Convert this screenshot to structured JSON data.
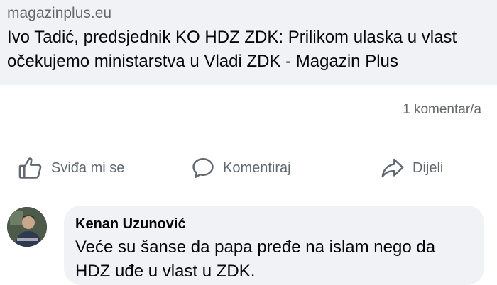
{
  "link_preview": {
    "domain": "magazinplus.eu",
    "title": "Ivo Tadić, predsjednik KO HDZ ZDK: Prilikom ulaska u vlast očekujemo ministarstva u Vladi ZDK - Magazin Plus"
  },
  "post_stats": {
    "comments_count": "1 komentar/a"
  },
  "actions": {
    "like_label": "Sviđa mi se",
    "comment_label": "Komentiraj",
    "share_label": "Dijeli",
    "like_icon": "thumbs-up-icon",
    "comment_icon": "speech-bubble-icon",
    "share_icon": "share-arrow-icon"
  },
  "comment": {
    "author": "Kenan Uzunović",
    "text": "Veće su šanse da papa pređe na islam nego da HDZ uđe u vlast u ZDK."
  },
  "colors": {
    "preview_background": "#f0f2f5",
    "secondary_text": "#65676b",
    "action_text": "#606770",
    "primary_text": "#050505"
  }
}
